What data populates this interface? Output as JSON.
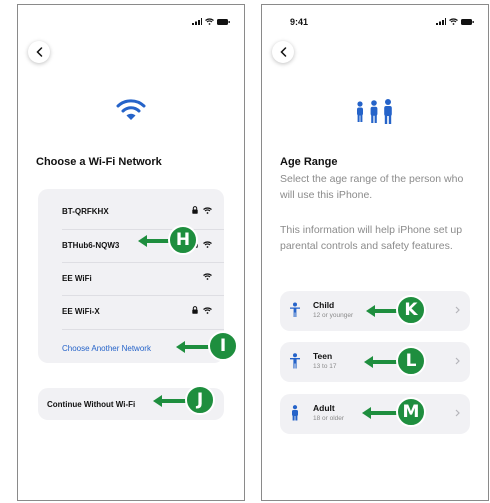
{
  "left_screen": {
    "title": "Choose a Wi-Fi Network",
    "networks": [
      {
        "name": "BT-QRFKHX",
        "locked": true
      },
      {
        "name": "BTHub6-NQW3",
        "locked": true
      },
      {
        "name": "EE WiFi",
        "locked": false
      },
      {
        "name": "EE WiFi-X",
        "locked": true
      }
    ],
    "choose_another": "Choose Another Network",
    "continue_without": "Continue Without Wi-Fi"
  },
  "right_screen": {
    "status_time": "9:41",
    "title": "Age Range",
    "description_1": "Select the age range of the person who will use this iPhone.",
    "description_2": "This information will help iPhone set up parental controls and safety features.",
    "options": [
      {
        "label": "Child",
        "sublabel": "12 or younger"
      },
      {
        "label": "Teen",
        "sublabel": "13 to 17"
      },
      {
        "label": "Adult",
        "sublabel": "18 or older"
      }
    ]
  },
  "callouts": {
    "h": "H",
    "i": "I",
    "j": "J",
    "k": "K",
    "l": "L",
    "m": "M"
  },
  "colors": {
    "accent_blue": "#2563c9",
    "callout_green": "#1e8e3e"
  }
}
